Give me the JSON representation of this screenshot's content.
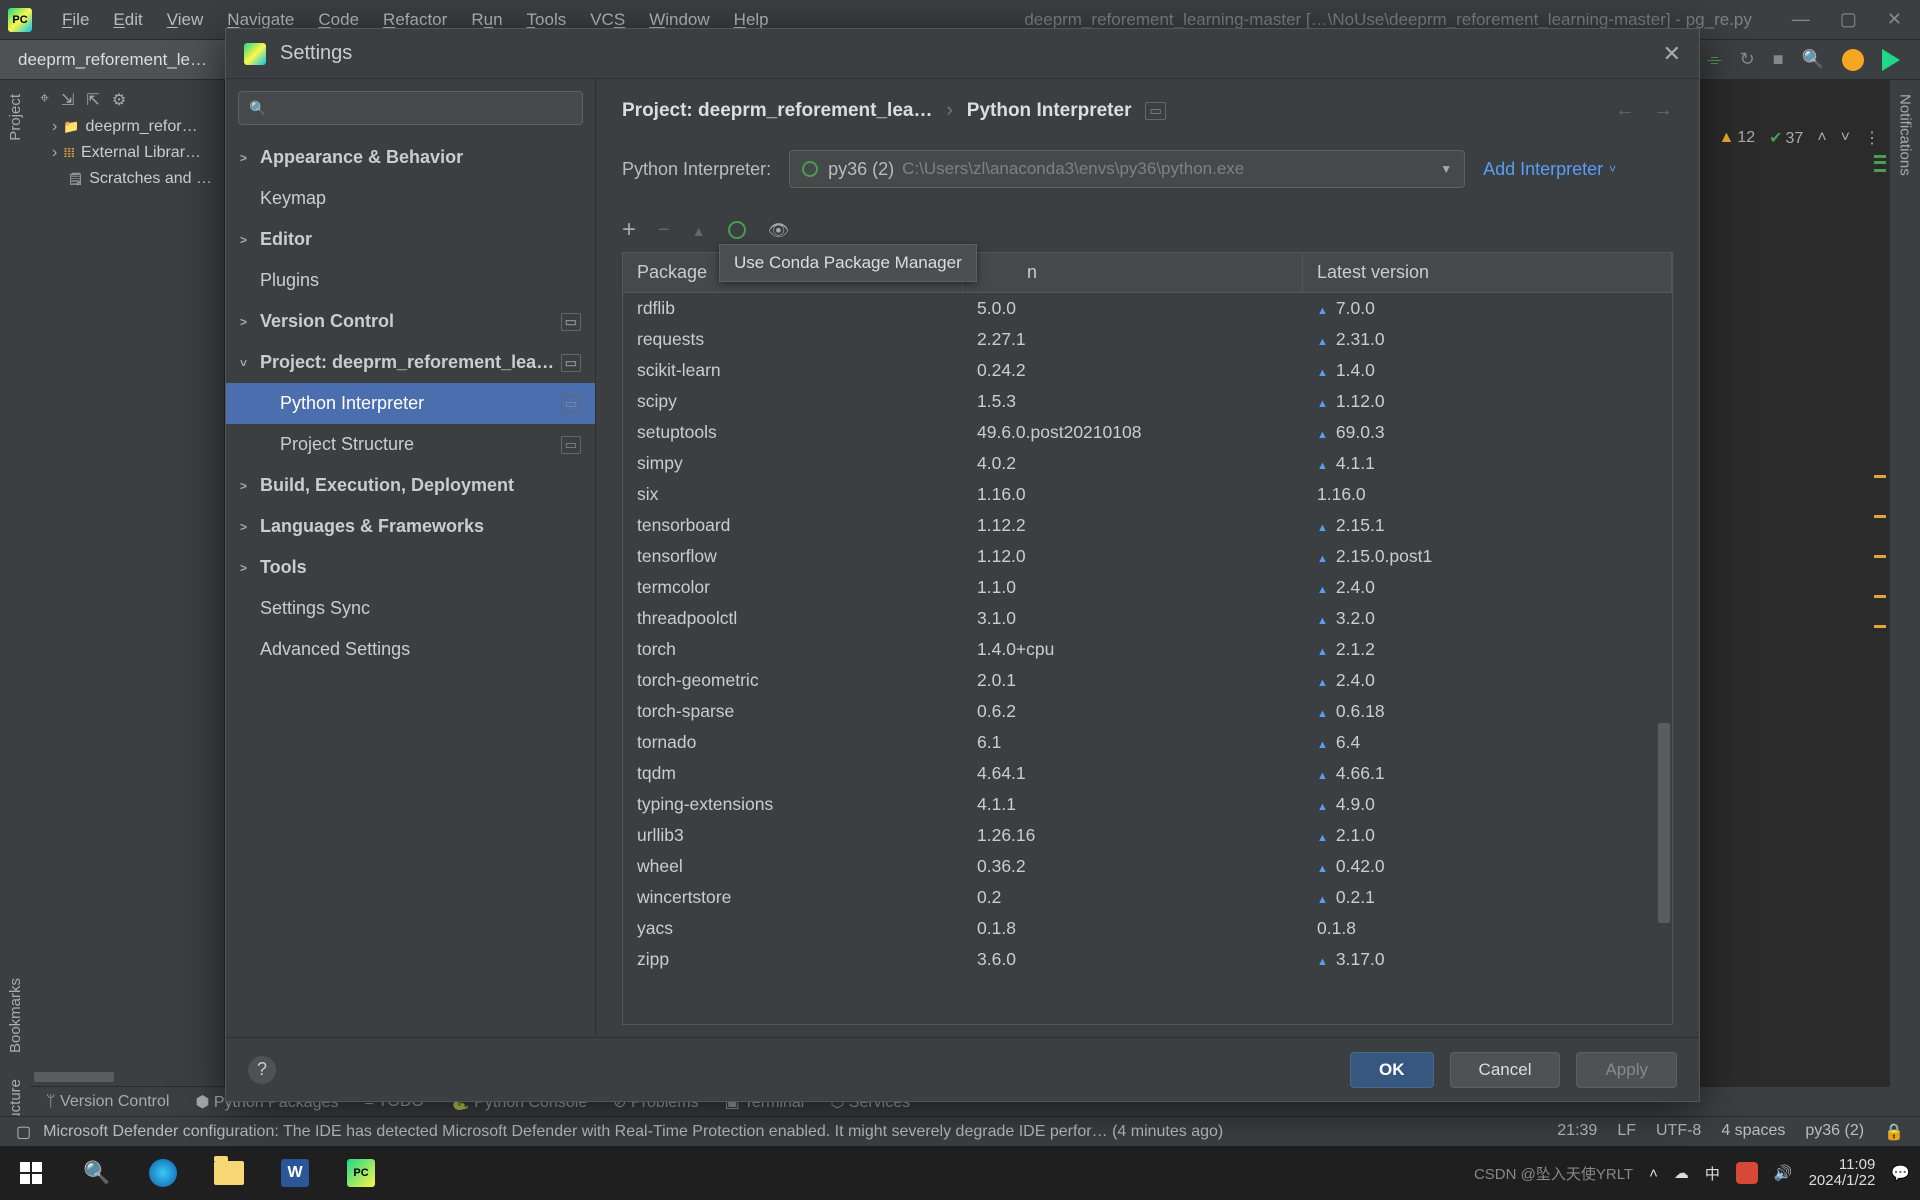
{
  "menu": {
    "items": [
      "File",
      "Edit",
      "View",
      "Navigate",
      "Code",
      "Refactor",
      "Run",
      "Tools",
      "VCS",
      "Window",
      "Help"
    ],
    "window_title": "deeprm_reforement_learning-master […\\NoUse\\deeprm_reforement_learning-master] - pg_re.py"
  },
  "tab": {
    "name": "deeprm_reforement_le…"
  },
  "left_gutter": {
    "tabs": [
      "Project",
      "Bookmarks",
      "Structure"
    ]
  },
  "right_gutter": {
    "tab": "Notifications"
  },
  "project_tree": {
    "items": [
      "deeprm_refor…",
      "External Librar…",
      "Scratches and …"
    ]
  },
  "editor_hints": {
    "warnings": "12",
    "weak": "37"
  },
  "dialog": {
    "title": "Settings",
    "search_placeholder": "",
    "categories": [
      {
        "label": "Appearance & Behavior",
        "bold": true,
        "chev": ">"
      },
      {
        "label": "Keymap",
        "bold": false
      },
      {
        "label": "Editor",
        "bold": true,
        "chev": ">"
      },
      {
        "label": "Plugins",
        "bold": false
      },
      {
        "label": "Version Control",
        "bold": true,
        "chev": ">",
        "badge": "▭"
      },
      {
        "label": "Project: deeprm_reforement_lea…",
        "bold": true,
        "chev": "˅",
        "badge": "▭"
      },
      {
        "label": "Python Interpreter",
        "bold": false,
        "lv2": true,
        "selected": true,
        "badge": "▭"
      },
      {
        "label": "Project Structure",
        "bold": false,
        "lv2": true,
        "badge": "▭"
      },
      {
        "label": "Build, Execution, Deployment",
        "bold": true,
        "chev": ">"
      },
      {
        "label": "Languages & Frameworks",
        "bold": true,
        "chev": ">"
      },
      {
        "label": "Tools",
        "bold": true,
        "chev": ">"
      },
      {
        "label": "Settings Sync",
        "bold": false
      },
      {
        "label": "Advanced Settings",
        "bold": false
      }
    ],
    "breadcrumb": {
      "project": "Project: deeprm_reforement_lea…",
      "page": "Python Interpreter"
    },
    "interpreter": {
      "label": "Python Interpreter:",
      "name": "py36 (2)",
      "path": "C:\\Users\\zl\\anaconda3\\envs\\py36\\python.exe",
      "add_link": "Add Interpreter"
    },
    "tooltip": "Use Conda Package Manager",
    "columns": {
      "c1": "Package",
      "c2": "n",
      "c3": "Latest version"
    },
    "packages": [
      {
        "name": "rdflib",
        "ver": "5.0.0",
        "latest": "7.0.0",
        "up": true
      },
      {
        "name": "requests",
        "ver": "2.27.1",
        "latest": "2.31.0",
        "up": true
      },
      {
        "name": "scikit-learn",
        "ver": "0.24.2",
        "latest": "1.4.0",
        "up": true
      },
      {
        "name": "scipy",
        "ver": "1.5.3",
        "latest": "1.12.0",
        "up": true
      },
      {
        "name": "setuptools",
        "ver": "49.6.0.post20210108",
        "latest": "69.0.3",
        "up": true
      },
      {
        "name": "simpy",
        "ver": "4.0.2",
        "latest": "4.1.1",
        "up": true
      },
      {
        "name": "six",
        "ver": "1.16.0",
        "latest": "1.16.0",
        "up": false
      },
      {
        "name": "tensorboard",
        "ver": "1.12.2",
        "latest": "2.15.1",
        "up": true
      },
      {
        "name": "tensorflow",
        "ver": "1.12.0",
        "latest": "2.15.0.post1",
        "up": true
      },
      {
        "name": "termcolor",
        "ver": "1.1.0",
        "latest": "2.4.0",
        "up": true
      },
      {
        "name": "threadpoolctl",
        "ver": "3.1.0",
        "latest": "3.2.0",
        "up": true
      },
      {
        "name": "torch",
        "ver": "1.4.0+cpu",
        "latest": "2.1.2",
        "up": true
      },
      {
        "name": "torch-geometric",
        "ver": "2.0.1",
        "latest": "2.4.0",
        "up": true
      },
      {
        "name": "torch-sparse",
        "ver": "0.6.2",
        "latest": "0.6.18",
        "up": true
      },
      {
        "name": "tornado",
        "ver": "6.1",
        "latest": "6.4",
        "up": true
      },
      {
        "name": "tqdm",
        "ver": "4.64.1",
        "latest": "4.66.1",
        "up": true
      },
      {
        "name": "typing-extensions",
        "ver": "4.1.1",
        "latest": "4.9.0",
        "up": true
      },
      {
        "name": "urllib3",
        "ver": "1.26.16",
        "latest": "2.1.0",
        "up": true
      },
      {
        "name": "wheel",
        "ver": "0.36.2",
        "latest": "0.42.0",
        "up": true
      },
      {
        "name": "wincertstore",
        "ver": "0.2",
        "latest": "0.2.1",
        "up": true
      },
      {
        "name": "yacs",
        "ver": "0.1.8",
        "latest": "0.1.8",
        "up": false
      },
      {
        "name": "zipp",
        "ver": "3.6.0",
        "latest": "3.17.0",
        "up": true
      }
    ],
    "buttons": {
      "ok": "OK",
      "cancel": "Cancel",
      "apply": "Apply"
    }
  },
  "bottom_tools": [
    "Version Control",
    "Python Packages",
    "TODO",
    "Python Console",
    "Problems",
    "Terminal",
    "Services"
  ],
  "status": {
    "msg": "Microsoft Defender configuration: The IDE has detected Microsoft Defender with Real-Time Protection enabled. It might severely degrade IDE perfor… (4 minutes ago)",
    "pos": "21:39",
    "eol": "LF",
    "enc": "UTF-8",
    "indent": "4 spaces",
    "interp": "py36 (2)"
  },
  "taskbar": {
    "time": "11:09",
    "date": "2024/1/22",
    "watermark": "CSDN @坠入天使YRLT",
    "ime": "中"
  }
}
